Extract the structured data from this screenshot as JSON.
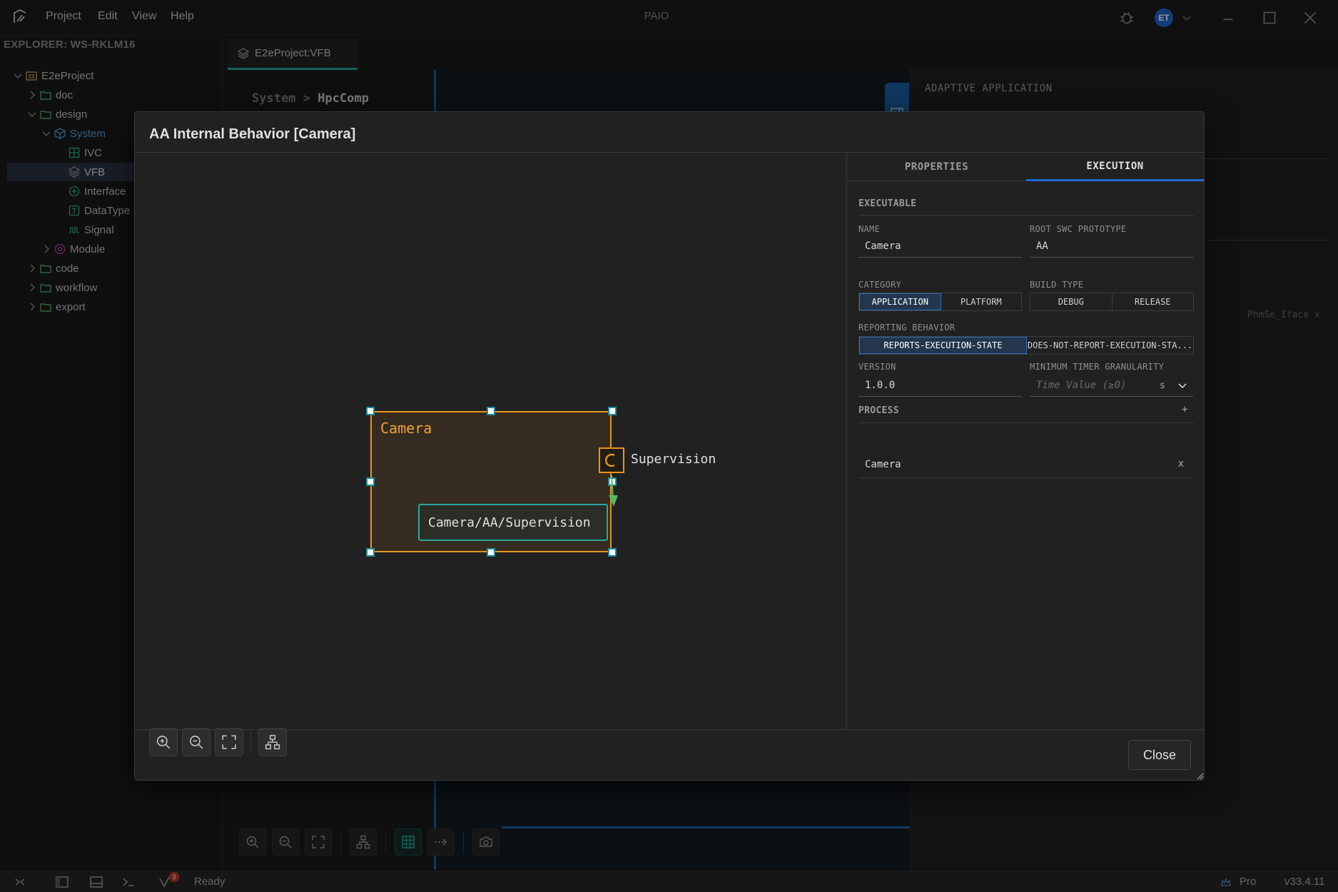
{
  "titlebar": {
    "menu": [
      "Project",
      "Edit",
      "View",
      "Help"
    ],
    "app_title": "PAIO",
    "avatar_initials": "ET"
  },
  "explorer": {
    "header": "EXPLORER: WS-RKLM16",
    "items": [
      {
        "label": "E2eProject",
        "icon": "project-folder-icon"
      },
      {
        "label": "doc",
        "icon": "folder-icon"
      },
      {
        "label": "design",
        "icon": "folder-icon"
      },
      {
        "label": "System",
        "icon": "cube-icon"
      },
      {
        "label": "IVC",
        "icon": "grid-icon"
      },
      {
        "label": "VFB",
        "icon": "layers-icon"
      },
      {
        "label": "Interface",
        "icon": "interface-icon"
      },
      {
        "label": "DataType",
        "icon": "datatype-icon"
      },
      {
        "label": "Signal",
        "icon": "signal-icon"
      },
      {
        "label": "Module",
        "icon": "module-icon"
      },
      {
        "label": "code",
        "icon": "folder-icon"
      },
      {
        "label": "workflow",
        "icon": "folder-icon"
      },
      {
        "label": "export",
        "icon": "folder-icon"
      }
    ]
  },
  "editor": {
    "tab_label": "E2eProject:VFB",
    "breadcrumb_parent": "System",
    "breadcrumb_sep": ">",
    "breadcrumb_current": "HpcComp"
  },
  "right_panel": {
    "title": "ADAPTIVE APPLICATION",
    "ghost_item": "PhmSe_Iface x"
  },
  "dialog": {
    "title": "AA Internal Behavior [Camera]",
    "close_label": "Close",
    "diagram": {
      "component_label": "Camera",
      "process_label": "Camera/AA/Supervision",
      "port_label": "Supervision"
    },
    "tabs": [
      "PROPERTIES",
      "EXECUTION"
    ],
    "execution": {
      "executable_title": "EXECUTABLE",
      "name_label": "NAME",
      "name_value": "Camera",
      "root_label": "ROOT SWC PROTOTYPE",
      "root_value": "AA",
      "category_label": "CATEGORY",
      "category_options": [
        "APPLICATION",
        "PLATFORM"
      ],
      "build_label": "BUILD TYPE",
      "build_options": [
        "DEBUG",
        "RELEASE"
      ],
      "reporting_label": "REPORTING BEHAVIOR",
      "reporting_options": [
        "REPORTS-EXECUTION-STATE",
        "DOES-NOT-REPORT-EXECUTION-STA..."
      ],
      "version_label": "VERSION",
      "version_value": "1.0.0",
      "timer_label": "MINIMUM TIMER GRANULARITY",
      "timer_placeholder": "Time Value (≥0)",
      "timer_unit": "s",
      "process_title": "PROCESS",
      "process_add": "+",
      "process_item": "Camera",
      "process_remove": "x"
    }
  },
  "statusbar": {
    "badge": "3",
    "status": "Ready",
    "plan": "Pro",
    "version": "v33.4.11"
  }
}
